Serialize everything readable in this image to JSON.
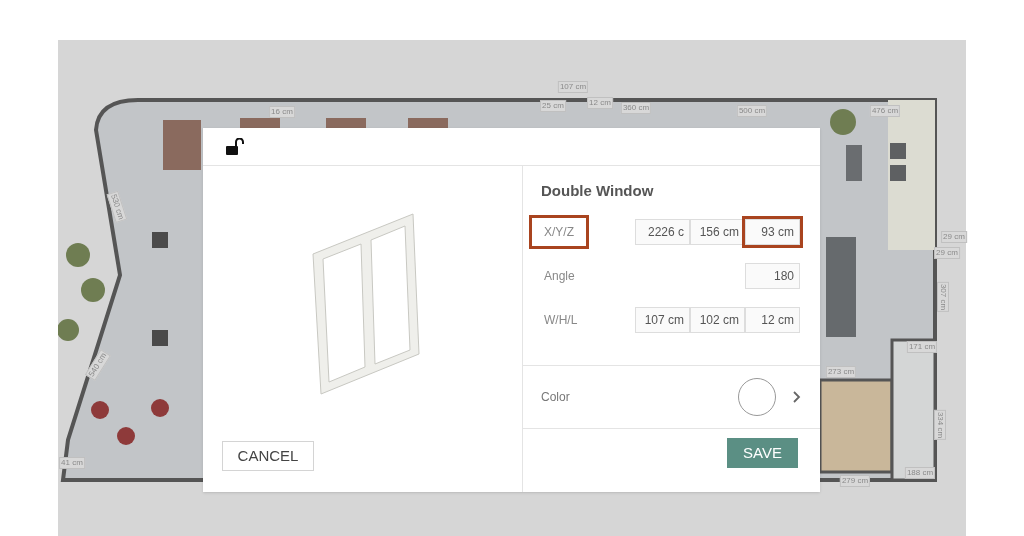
{
  "plan": {
    "labels": [
      {
        "text": "107 cm"
      },
      {
        "text": "16 cm"
      },
      {
        "text": "25 cm"
      },
      {
        "text": "12 cm"
      },
      {
        "text": "360 cm"
      },
      {
        "text": "500 cm"
      },
      {
        "text": "476 cm"
      },
      {
        "text": "530 cm"
      },
      {
        "text": "540 cm"
      },
      {
        "text": "41 cm"
      },
      {
        "text": "273 cm"
      },
      {
        "text": "279 cm"
      },
      {
        "text": "188 cm"
      },
      {
        "text": "171 cm"
      },
      {
        "text": "29 cm"
      },
      {
        "text": "29 cm"
      },
      {
        "text": "307 cm"
      },
      {
        "text": "334 cm"
      }
    ]
  },
  "dialog": {
    "title": "Double Window",
    "rows": [
      {
        "label": "X/Y/Z",
        "highlighted": true,
        "values": [
          {
            "text": "2226 c",
            "highlighted": false
          },
          {
            "text": "156 cm",
            "highlighted": false
          },
          {
            "text": "93 cm",
            "highlighted": true
          }
        ]
      },
      {
        "label": "Angle",
        "highlighted": false,
        "values": [
          {
            "text": "180",
            "highlighted": false
          }
        ]
      },
      {
        "label": "W/H/L",
        "highlighted": false,
        "values": [
          {
            "text": "107 cm",
            "highlighted": false
          },
          {
            "text": "102 cm",
            "highlighted": false
          },
          {
            "text": "12 cm",
            "highlighted": false
          }
        ]
      }
    ],
    "color": {
      "label": "Color"
    },
    "cancel": "CANCEL",
    "save": "SAVE"
  }
}
